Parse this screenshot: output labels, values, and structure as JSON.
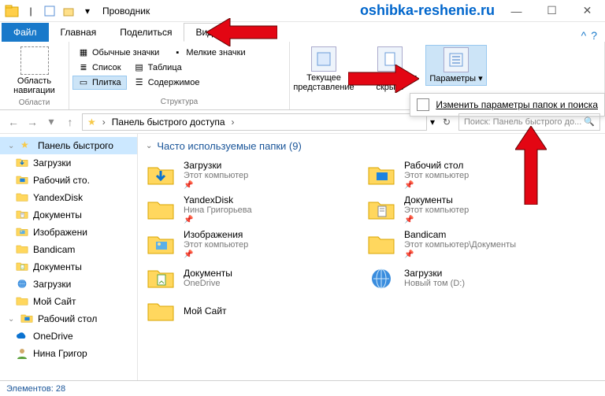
{
  "window": {
    "title": "Проводник",
    "watermark": "oshibka-reshenie.ru"
  },
  "tabs": {
    "file": "Файл",
    "home": "Главная",
    "share": "Поделиться",
    "view": "Вид"
  },
  "ribbon": {
    "nav": {
      "label": "Область навигации",
      "group": "Области"
    },
    "layout": {
      "items": [
        "Обычные значки",
        "Мелкие значки",
        "Список",
        "Таблица",
        "Плитка",
        "Содержимое"
      ],
      "group": "Структура"
    },
    "current": {
      "btn1": "Текущее представление",
      "btn2": "Показать или скрыть",
      "btn3": "Параметры"
    },
    "options_popup": "Изменить параметры папок и поиска"
  },
  "address": {
    "crumb": "Панель быстрого доступа"
  },
  "search": {
    "placeholder": "Поиск: Панель быстрого до..."
  },
  "sidebar": {
    "items": [
      {
        "label": "Панель быстрого",
        "icon": "star",
        "top": true,
        "selected": true
      },
      {
        "label": "Загрузки",
        "icon": "download"
      },
      {
        "label": "Рабочий сто.",
        "icon": "desktop"
      },
      {
        "label": "YandexDisk",
        "icon": "folder"
      },
      {
        "label": "Документы",
        "icon": "docs"
      },
      {
        "label": "Изображени",
        "icon": "pics"
      },
      {
        "label": "Bandicam",
        "icon": "folder"
      },
      {
        "label": "Документы",
        "icon": "docs2"
      },
      {
        "label": "Загрузки",
        "icon": "world"
      },
      {
        "label": "Мой Сайт",
        "icon": "folder"
      },
      {
        "label": "Рабочий стол",
        "icon": "desktop",
        "top": true
      },
      {
        "label": "OneDrive",
        "icon": "cloud"
      },
      {
        "label": "Нина Григор",
        "icon": "user"
      }
    ]
  },
  "content": {
    "header": "Часто используемые папки (9)",
    "folders": [
      {
        "name": "Загрузки",
        "sub": "Этот компьютер",
        "icon": "download",
        "pin": true
      },
      {
        "name": "Рабочий стол",
        "sub": "Этот компьютер",
        "icon": "desktop",
        "pin": true
      },
      {
        "name": "YandexDisk",
        "sub": "Нина Григорьева",
        "icon": "folder",
        "pin": true
      },
      {
        "name": "Документы",
        "sub": "Этот компьютер",
        "icon": "docs",
        "pin": true
      },
      {
        "name": "Изображения",
        "sub": "Этот компьютер",
        "icon": "pics",
        "pin": true
      },
      {
        "name": "Bandicam",
        "sub": "Этот компьютер\\Документы",
        "icon": "folder",
        "pin": true
      },
      {
        "name": "Документы",
        "sub": "OneDrive",
        "icon": "docs2",
        "pin": false
      },
      {
        "name": "Загрузки",
        "sub": "Новый том (D:)",
        "icon": "world",
        "pin": false
      },
      {
        "name": "Мой Сайт",
        "sub": "",
        "icon": "folder",
        "pin": false
      }
    ]
  },
  "status": {
    "text": "Элементов: 28"
  }
}
